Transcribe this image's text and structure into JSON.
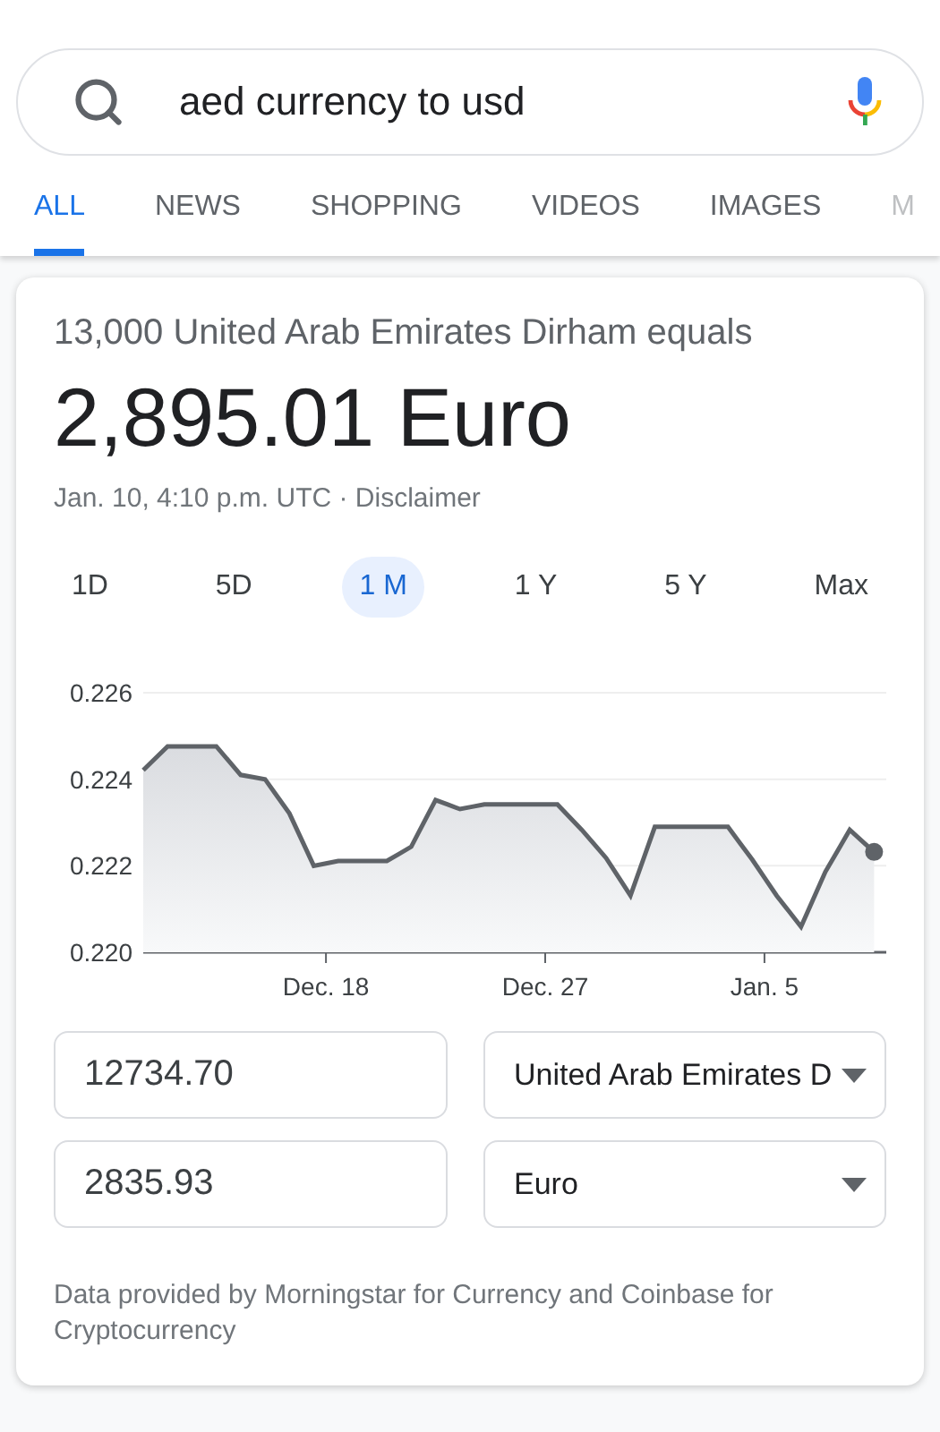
{
  "search": {
    "value": "aed currency to usd"
  },
  "tabs": [
    {
      "label": "ALL",
      "selected": true
    },
    {
      "label": "NEWS",
      "selected": false
    },
    {
      "label": "SHOPPING",
      "selected": false
    },
    {
      "label": "VIDEOS",
      "selected": false
    },
    {
      "label": "IMAGES",
      "selected": false
    },
    {
      "label": "M",
      "selected": false
    }
  ],
  "card": {
    "headline": "13,000 United Arab Emirates Dirham equals",
    "result": "2,895.01 Euro",
    "timestamp": "Jan. 10, 4:10 p.m. UTC · ",
    "disclaimer": "Disclaimer",
    "ranges": [
      {
        "label": "1D",
        "selected": false
      },
      {
        "label": "5D",
        "selected": false
      },
      {
        "label": "1 M",
        "selected": true
      },
      {
        "label": "1 Y",
        "selected": false
      },
      {
        "label": "5 Y",
        "selected": false
      },
      {
        "label": "Max",
        "selected": false
      }
    ],
    "chart_data": {
      "type": "area",
      "categories": [
        null,
        null,
        null,
        null,
        null,
        null,
        null,
        null,
        null,
        null,
        null,
        null,
        null,
        null,
        null,
        "Dec. 18",
        null,
        null,
        null,
        null,
        null,
        null,
        null,
        null,
        null,
        null,
        null,
        null,
        null,
        null,
        null,
        null,
        null,
        "Dec. 27",
        null,
        null,
        null,
        null,
        null,
        null,
        null,
        null,
        null,
        null,
        null,
        null,
        null,
        null,
        null,
        null,
        null,
        "Jan. 5",
        null,
        null,
        null,
        null,
        null,
        null,
        null,
        null,
        null
      ],
      "series": [
        {
          "color": "#5f6368",
          "values": [
            0.22421,
            0.224485,
            0.22476,
            0.22476,
            0.22476,
            0.22476,
            0.22476,
            0.22443,
            0.2241,
            0.22405,
            0.224,
            0.223605,
            0.22321,
            0.222605,
            0.222,
            0.222055,
            0.22211,
            0.22211,
            0.22211,
            0.22211,
            0.22211,
            0.222275,
            0.22244,
            0.22298,
            0.22352,
            0.223415,
            0.22331,
            0.223365,
            0.22342,
            0.22342,
            0.22342,
            0.22342,
            0.22342,
            0.22342,
            0.22342,
            0.223125,
            0.22283,
            0.222505,
            0.22218,
            0.221745,
            0.22131,
            0.222105,
            0.2229,
            0.2229,
            0.2229,
            0.2229,
            0.2229,
            0.2229,
            0.2229,
            0.22252,
            0.22214,
            0.221725,
            0.22131,
            0.22095,
            0.22059,
            0.221225,
            0.22186,
            0.222345,
            0.22283,
            0.222575,
            0.22232
          ]
        }
      ],
      "ylim": [
        0.22,
        0.226
      ],
      "yticks": [
        {
          "value": 0.226,
          "label": "0.226"
        },
        {
          "value": 0.224,
          "label": "0.224"
        },
        {
          "value": 0.222,
          "label": "0.222"
        },
        {
          "value": 0.22,
          "label": "0.220"
        }
      ]
    },
    "converter": [
      {
        "amount": "12734.70",
        "currency": "United Arab Emirates D"
      },
      {
        "amount": "2835.93",
        "currency": "Euro"
      }
    ],
    "footer": "Data provided by Morningstar for Currency and Coinbase for Cryptocurrency"
  }
}
